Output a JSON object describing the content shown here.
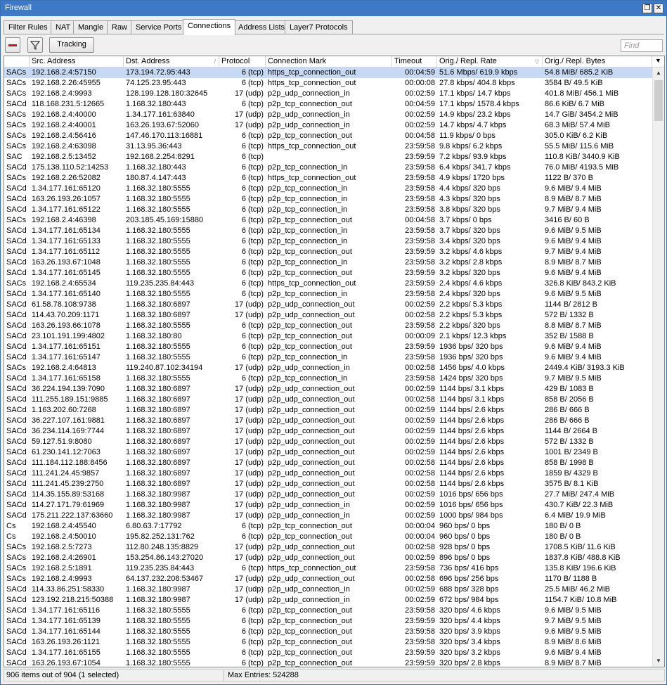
{
  "window": {
    "title": "Firewall",
    "restore_glyph": "❐",
    "close_glyph": "✕"
  },
  "tabs": [
    {
      "label": "Filter Rules",
      "active": false
    },
    {
      "label": "NAT",
      "active": false
    },
    {
      "label": "Mangle",
      "active": false
    },
    {
      "label": "Raw",
      "active": false
    },
    {
      "label": "Service Ports",
      "active": false
    },
    {
      "label": "Connections",
      "active": true
    },
    {
      "label": "Address Lists",
      "active": false
    },
    {
      "label": "Layer7 Protocols",
      "active": false
    }
  ],
  "toolbar": {
    "tracking_label": "Tracking",
    "find_placeholder": "Find",
    "remove_color": "#c0142b"
  },
  "columns": [
    "",
    "Src. Address",
    "Dst. Address",
    "Protocol",
    "Connection Mark",
    "Timeout",
    "Orig./ Repl. Rate",
    "Orig./ Repl. Bytes"
  ],
  "sort_glyph": "▽",
  "menu_glyph": "▼",
  "scroll": {
    "up_glyph": "▲",
    "down_glyph": "▼"
  },
  "colors": {
    "title_bar": "#3d79c6",
    "selected_row": "#c8daf3"
  },
  "rows": [
    [
      "SACs",
      "192.168.2.4:57150",
      "173.194.72.95:443",
      "6 (tcp)",
      "https_tcp_connection_out",
      "00:04:59",
      "51.6 Mbps/ 619.9 kbps",
      "54.8 MiB/ 685.2 KiB"
    ],
    [
      "SACs",
      "192.168.2.26:45955",
      "74.125.23.95:443",
      "6 (tcp)",
      "https_tcp_connection_out",
      "00:00:08",
      "27.8 kbps/ 404.8 kbps",
      "3584 B/ 49.5 KiB"
    ],
    [
      "SACs",
      "192.168.2.4:9993",
      "128.199.128.180:32645",
      "17 (udp)",
      "p2p_udp_connection_in",
      "00:02:59",
      "17.1 kbps/ 14.7 kbps",
      "401.8 MiB/ 456.1 MiB"
    ],
    [
      "SACd",
      "118.168.231.5:12665",
      "1.168.32.180:443",
      "6 (tcp)",
      "p2p_tcp_connection_out",
      "00:04:59",
      "17.1 kbps/ 1578.4 kbps",
      "86.6 KiB/ 6.7 MiB"
    ],
    [
      "SACs",
      "192.168.2.4:40000",
      "1.34.177.161:63840",
      "17 (udp)",
      "p2p_udp_connection_in",
      "00:02:59",
      "14.9 kbps/ 23.2 kbps",
      "14.7 GiB/ 3454.2 MiB"
    ],
    [
      "SACs",
      "192.168.2.4:40001",
      "163.26.193.67:52060",
      "17 (udp)",
      "p2p_udp_connection_in",
      "00:02:59",
      "14.7 kbps/ 4.7 kbps",
      "68.3 MiB/ 57.4 MiB"
    ],
    [
      "SACs",
      "192.168.2.4:56416",
      "147.46.170.113:16881",
      "6 (tcp)",
      "p2p_tcp_connection_out",
      "00:04:58",
      "11.9 kbps/ 0 bps",
      "305.0 KiB/ 6.2 KiB"
    ],
    [
      "SACs",
      "192.168.2.4:63098",
      "31.13.95.36:443",
      "6 (tcp)",
      "https_tcp_connection_out",
      "23:59:58",
      "9.8 kbps/ 6.2 kbps",
      "55.5 MiB/ 115.6 MiB"
    ],
    [
      "SAC",
      "192.168.2.5:13452",
      "192.168.2.254:8291",
      "6 (tcp)",
      "",
      "23:59:59",
      "7.2 kbps/ 93.9 kbps",
      "110.8 KiB/ 3440.9 KiB"
    ],
    [
      "SACd",
      "175.138.110.52:14253",
      "1.168.32.180:443",
      "6 (tcp)",
      "p2p_tcp_connection_in",
      "23:59:58",
      "6.4 kbps/ 341.7 kbps",
      "76.0 MiB/ 4193.5 MiB"
    ],
    [
      "SACs",
      "192.168.2.26:52082",
      "180.87.4.147:443",
      "6 (tcp)",
      "https_tcp_connection_out",
      "23:59:58",
      "4.9 kbps/ 1720 bps",
      "1122 B/ 370 B"
    ],
    [
      "SACd",
      "1.34.177.161:65120",
      "1.168.32.180:5555",
      "6 (tcp)",
      "p2p_tcp_connection_in",
      "23:59:58",
      "4.4 kbps/ 320 bps",
      "9.6 MiB/ 9.4 MiB"
    ],
    [
      "SACd",
      "163.26.193.26:1057",
      "1.168.32.180:5555",
      "6 (tcp)",
      "p2p_tcp_connection_in",
      "23:59:58",
      "4.3 kbps/ 320 bps",
      "8.9 MiB/ 8.7 MiB"
    ],
    [
      "SACd",
      "1.34.177.161:65122",
      "1.168.32.180:5555",
      "6 (tcp)",
      "p2p_tcp_connection_in",
      "23:59:58",
      "3.8 kbps/ 320 bps",
      "9.7 MiB/ 9.4 MiB"
    ],
    [
      "SACs",
      "192.168.2.4:46398",
      "203.185.45.169:15880",
      "6 (tcp)",
      "p2p_tcp_connection_out",
      "00:04:58",
      "3.7 kbps/ 0 bps",
      "3416 B/ 60 B"
    ],
    [
      "SACd",
      "1.34.177.161:65134",
      "1.168.32.180:5555",
      "6 (tcp)",
      "p2p_tcp_connection_in",
      "23:59:58",
      "3.7 kbps/ 320 bps",
      "9.6 MiB/ 9.5 MiB"
    ],
    [
      "SACd",
      "1.34.177.161:65133",
      "1.168.32.180:5555",
      "6 (tcp)",
      "p2p_tcp_connection_in",
      "23:59:58",
      "3.4 kbps/ 320 bps",
      "9.6 MiB/ 9.4 MiB"
    ],
    [
      "SACd",
      "1.34.177.161:65112",
      "1.168.32.180:5555",
      "6 (tcp)",
      "p2p_tcp_connection_out",
      "23:59:59",
      "3.2 kbps/ 4.6 kbps",
      "9.7 MiB/ 9.4 MiB"
    ],
    [
      "SACd",
      "163.26.193.67:1048",
      "1.168.32.180:5555",
      "6 (tcp)",
      "p2p_tcp_connection_in",
      "23:59:58",
      "3.2 kbps/ 2.8 kbps",
      "8.9 MiB/ 8.7 MiB"
    ],
    [
      "SACd",
      "1.34.177.161:65145",
      "1.168.32.180:5555",
      "6 (tcp)",
      "p2p_tcp_connection_out",
      "23:59:59",
      "3.2 kbps/ 320 bps",
      "9.6 MiB/ 9.4 MiB"
    ],
    [
      "SACs",
      "192.168.2.4:65534",
      "119.235.235.84:443",
      "6 (tcp)",
      "https_tcp_connection_out",
      "23:59:59",
      "2.4 kbps/ 4.6 kbps",
      "326.8 KiB/ 843.2 KiB"
    ],
    [
      "SACd",
      "1.34.177.161:65140",
      "1.168.32.180:5555",
      "6 (tcp)",
      "p2p_tcp_connection_in",
      "23:59:58",
      "2.4 kbps/ 320 bps",
      "9.6 MiB/ 9.5 MiB"
    ],
    [
      "SACd",
      "61.58.78.108:9738",
      "1.168.32.180:6897",
      "17 (udp)",
      "p2p_udp_connection_out",
      "00:02:59",
      "2.2 kbps/ 5.3 kbps",
      "1144 B/ 2812 B"
    ],
    [
      "SACd",
      "114.43.70.209:1171",
      "1.168.32.180:6897",
      "17 (udp)",
      "p2p_udp_connection_out",
      "00:02:58",
      "2.2 kbps/ 5.3 kbps",
      "572 B/ 1332 B"
    ],
    [
      "SACd",
      "163.26.193.66:1078",
      "1.168.32.180:5555",
      "6 (tcp)",
      "p2p_tcp_connection_out",
      "23:59:58",
      "2.2 kbps/ 320 bps",
      "8.8 MiB/ 8.7 MiB"
    ],
    [
      "SACd",
      "23.101.191.199:4802",
      "1.168.32.180:80",
      "6 (tcp)",
      "p2p_tcp_connection_out",
      "00:00:09",
      "2.1 kbps/ 12.3 kbps",
      "352 B/ 1588 B"
    ],
    [
      "SACd",
      "1.34.177.161:65151",
      "1.168.32.180:5555",
      "6 (tcp)",
      "p2p_tcp_connection_out",
      "23:59:59",
      "1936 bps/ 320 bps",
      "9.6 MiB/ 9.4 MiB"
    ],
    [
      "SACd",
      "1.34.177.161:65147",
      "1.168.32.180:5555",
      "6 (tcp)",
      "p2p_tcp_connection_in",
      "23:59:58",
      "1936 bps/ 320 bps",
      "9.6 MiB/ 9.4 MiB"
    ],
    [
      "SACs",
      "192.168.2.4:64813",
      "119.240.87.102:34194",
      "17 (udp)",
      "p2p_udp_connection_in",
      "00:02:58",
      "1456 bps/ 4.0 kbps",
      "2449.4 KiB/ 3193.3 KiB"
    ],
    [
      "SACd",
      "1.34.177.161:65158",
      "1.168.32.180:5555",
      "6 (tcp)",
      "p2p_tcp_connection_in",
      "23:59:58",
      "1424 bps/ 320 bps",
      "9.7 MiB/ 9.5 MiB"
    ],
    [
      "SACd",
      "36.224.194.139:7090",
      "1.168.32.180:6897",
      "17 (udp)",
      "p2p_udp_connection_out",
      "00:02:59",
      "1144 bps/ 3.1 kbps",
      "429 B/ 1083 B"
    ],
    [
      "SACd",
      "111.255.189.151:9885",
      "1.168.32.180:6897",
      "17 (udp)",
      "p2p_udp_connection_out",
      "00:02:58",
      "1144 bps/ 3.1 kbps",
      "858 B/ 2056 B"
    ],
    [
      "SACd",
      "1.163.202.60:7268",
      "1.168.32.180:6897",
      "17 (udp)",
      "p2p_udp_connection_out",
      "00:02:59",
      "1144 bps/ 2.6 kbps",
      "286 B/ 666 B"
    ],
    [
      "SACd",
      "36.227.107.161:9881",
      "1.168.32.180:6897",
      "17 (udp)",
      "p2p_udp_connection_out",
      "00:02:59",
      "1144 bps/ 2.6 kbps",
      "286 B/ 666 B"
    ],
    [
      "SACd",
      "36.234.114.169:7744",
      "1.168.32.180:6897",
      "17 (udp)",
      "p2p_udp_connection_out",
      "00:02:59",
      "1144 bps/ 2.6 kbps",
      "1144 B/ 2664 B"
    ],
    [
      "SACd",
      "59.127.51.9:8080",
      "1.168.32.180:6897",
      "17 (udp)",
      "p2p_udp_connection_out",
      "00:02:59",
      "1144 bps/ 2.6 kbps",
      "572 B/ 1332 B"
    ],
    [
      "SACd",
      "61.230.141.12:7063",
      "1.168.32.180:6897",
      "17 (udp)",
      "p2p_udp_connection_out",
      "00:02:59",
      "1144 bps/ 2.6 kbps",
      "1001 B/ 2349 B"
    ],
    [
      "SACd",
      "111.184.112.188:8456",
      "1.168.32.180:6897",
      "17 (udp)",
      "p2p_udp_connection_out",
      "00:02:58",
      "1144 bps/ 2.6 kbps",
      "858 B/ 1998 B"
    ],
    [
      "SACd",
      "111.241.24.45:9857",
      "1.168.32.180:6897",
      "17 (udp)",
      "p2p_udp_connection_out",
      "00:02:58",
      "1144 bps/ 2.6 kbps",
      "1859 B/ 4329 B"
    ],
    [
      "SACd",
      "111.241.45.239:2750",
      "1.168.32.180:6897",
      "17 (udp)",
      "p2p_udp_connection_out",
      "00:02:58",
      "1144 bps/ 2.6 kbps",
      "3575 B/ 8.1 KiB"
    ],
    [
      "SACd",
      "114.35.155.89:53168",
      "1.168.32.180:9987",
      "17 (udp)",
      "p2p_udp_connection_out",
      "00:02:59",
      "1016 bps/ 656 bps",
      "27.7 MiB/ 247.4 MiB"
    ],
    [
      "SACd",
      "114.27.171.79:61969",
      "1.168.32.180:9987",
      "17 (udp)",
      "p2p_udp_connection_in",
      "00:02:59",
      "1016 bps/ 656 bps",
      "430.7 KiB/ 22.3 MiB"
    ],
    [
      "SACd",
      "175.211.222.137:63660",
      "1.168.32.180:9987",
      "17 (udp)",
      "p2p_udp_connection_in",
      "00:02:59",
      "1000 bps/ 984 bps",
      "6.4 MiB/ 19.9 MiB"
    ],
    [
      "Cs",
      "192.168.2.4:45540",
      "6.80.63.7:17792",
      "6 (tcp)",
      "p2p_tcp_connection_out",
      "00:00:04",
      "960 bps/ 0 bps",
      "180 B/ 0 B"
    ],
    [
      "Cs",
      "192.168.2.4:50010",
      "195.82.252.131:762",
      "6 (tcp)",
      "p2p_tcp_connection_out",
      "00:00:04",
      "960 bps/ 0 bps",
      "180 B/ 0 B"
    ],
    [
      "SACs",
      "192.168.2.5:7273",
      "112.80.248.135:8829",
      "17 (udp)",
      "p2p_udp_connection_out",
      "00:02:58",
      "928 bps/ 0 bps",
      "1708.5 KiB/ 11.6 KiB"
    ],
    [
      "SACs",
      "192.168.2.4:26901",
      "153.254.86.143:27020",
      "17 (udp)",
      "p2p_udp_connection_out",
      "00:02:59",
      "896 bps/ 0 bps",
      "1837.8 KiB/ 488.8 KiB"
    ],
    [
      "SACs",
      "192.168.2.5:1891",
      "119.235.235.84:443",
      "6 (tcp)",
      "https_tcp_connection_out",
      "23:59:58",
      "736 bps/ 416 bps",
      "135.8 KiB/ 196.6 KiB"
    ],
    [
      "SACs",
      "192.168.2.4:9993",
      "64.137.232.208:53467",
      "17 (udp)",
      "p2p_udp_connection_out",
      "00:02:58",
      "696 bps/ 256 bps",
      "1170 B/ 1188 B"
    ],
    [
      "SACd",
      "114.33.86.251:58330",
      "1.168.32.180:9987",
      "17 (udp)",
      "p2p_udp_connection_in",
      "00:02:59",
      "688 bps/ 328 bps",
      "25.5 MiB/ 46.2 MiB"
    ],
    [
      "SACd",
      "123.192.218.215:50388",
      "1.168.32.180:9987",
      "17 (udp)",
      "p2p_udp_connection_in",
      "00:02:59",
      "672 bps/ 984 bps",
      "1154.7 KiB/ 10.8 MiB"
    ],
    [
      "SACd",
      "1.34.177.161:65116",
      "1.168.32.180:5555",
      "6 (tcp)",
      "p2p_tcp_connection_out",
      "23:59:58",
      "320 bps/ 4.6 kbps",
      "9.6 MiB/ 9.5 MiB"
    ],
    [
      "SACd",
      "1.34.177.161:65139",
      "1.168.32.180:5555",
      "6 (tcp)",
      "p2p_tcp_connection_out",
      "23:59:59",
      "320 bps/ 4.4 kbps",
      "9.7 MiB/ 9.5 MiB"
    ],
    [
      "SACd",
      "1.34.177.161:65144",
      "1.168.32.180:5555",
      "6 (tcp)",
      "p2p_tcp_connection_out",
      "23:59:58",
      "320 bps/ 3.9 kbps",
      "9.6 MiB/ 9.5 MiB"
    ],
    [
      "SACd",
      "163.26.193.26:1121",
      "1.168.32.180:5555",
      "6 (tcp)",
      "p2p_tcp_connection_out",
      "23:59:58",
      "320 bps/ 3.4 kbps",
      "8.9 MiB/ 8.6 MiB"
    ],
    [
      "SACd",
      "1.34.177.161:65155",
      "1.168.32.180:5555",
      "6 (tcp)",
      "p2p_tcp_connection_out",
      "23:59:59",
      "320 bps/ 3.2 kbps",
      "9.6 MiB/ 9.4 MiB"
    ],
    [
      "SACd",
      "163.26.193.67:1054",
      "1.168.32.180:5555",
      "6 (tcp)",
      "p2p_tcp_connection_out",
      "23:59:59",
      "320 bps/ 2.8 kbps",
      "8.9 MiB/ 8.7 MiB"
    ]
  ],
  "selected_row": 0,
  "status": {
    "items": "906 items out of 904 (1 selected)",
    "max_entries": "Max Entries: 524288"
  }
}
